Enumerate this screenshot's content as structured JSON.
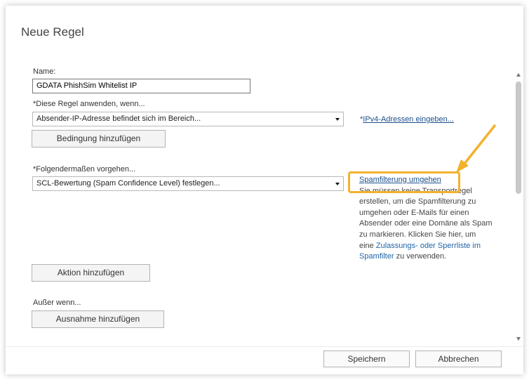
{
  "dialog": {
    "title": "Neue Regel"
  },
  "name_field": {
    "label": "Name:",
    "value": "GDATA PhishSim Whitelist IP"
  },
  "condition": {
    "label": "*Diese Regel anwenden, wenn...",
    "selected": "Absender-IP-Adresse befindet sich im Bereich...",
    "link": "IPv4-Adressen eingeben...",
    "link_prefix": "*",
    "add_button": "Bedingung hinzufügen"
  },
  "action": {
    "label": "*Folgendermaßen vorgehen...",
    "selected": "SCL-Bewertung (Spam Confidence Level) festlegen...",
    "add_button": "Aktion hinzufügen"
  },
  "help": {
    "title": "Spamfilterung umgehen",
    "text_before": "Sie müssen keine Transportregel erstellen, um die Spamfilterung zu umgehen oder E-Mails für einen Absender oder eine Domäne als Spam zu markieren. Klicken Sie hier, um eine",
    "link": "Zulassungs- oder Sperrliste im Spamfilter",
    "text_after": "zu verwenden."
  },
  "exception": {
    "label": "Außer wenn...",
    "add_button": "Ausnahme hinzufügen"
  },
  "footer": {
    "save": "Speichern",
    "cancel": "Abbrechen"
  },
  "colors": {
    "highlight": "#f2b22e",
    "link": "#1c4f8a"
  }
}
